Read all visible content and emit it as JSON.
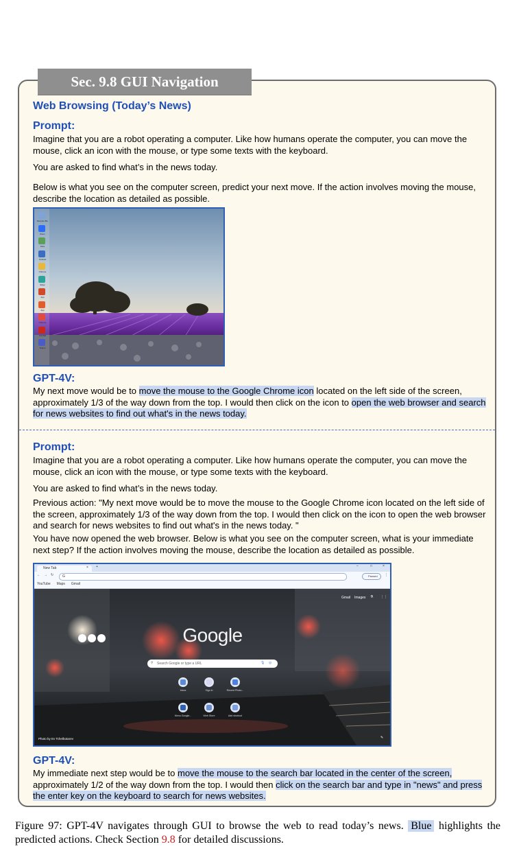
{
  "section": {
    "title": "Sec. 9.8 GUI Navigation"
  },
  "heading": "Web Browsing (Today’s News)",
  "prompt1": {
    "label": "Prompt:",
    "p1": "Imagine that you are a robot operating a computer. Like how humans operate the computer, you can move the mouse, click an icon with the mouse, or type some texts with the keyboard.",
    "p2": "You are asked to find what’s in the news today.",
    "p3": "Below is what you see on the computer screen, predict your next move. If the action involves moving the mouse, describe the location as detailed as possible."
  },
  "desktop": {
    "icons": [
      {
        "label": "Recycle Bin",
        "color": "#7fa3d6"
      },
      {
        "label": "Zoom",
        "color": "#2d6df6"
      },
      {
        "label": "Files",
        "color": "#5aa05a"
      },
      {
        "label": "Outlook",
        "color": "#3b6ec2"
      },
      {
        "label": "Chrome",
        "color": "#e9b73a"
      },
      {
        "label": "Edge",
        "color": "#2fa39a"
      },
      {
        "label": "App",
        "color": "#d04a2a"
      },
      {
        "label": "App",
        "color": "#e35d2b"
      },
      {
        "label": "Chrome",
        "color": "#e24b3b"
      },
      {
        "label": "Acrobat",
        "color": "#c9281e"
      },
      {
        "label": "Teams",
        "color": "#4a5cc5"
      }
    ]
  },
  "gpt1": {
    "label": "GPT-4V:",
    "t1": "My next move would be to ",
    "h1": "move the mouse to the Google Chrome icon",
    "t2": " located on the left side of the screen, approximately 1/3 of the way down from the top. I would then click on the icon to ",
    "h2": "open the web browser and search for news websites to find out what's in the news today."
  },
  "prompt2": {
    "label": "Prompt:",
    "p1": "Imagine that you are a robot operating a computer. Like how humans operate the computer, you can move the mouse, click an icon with the mouse, or type some texts with the keyboard.",
    "p2": "You are asked to find what’s in the news today.",
    "p3": "Previous action: \"My next move would be to move the mouse to the Google Chrome icon located on the left side of the screen, approximately 1/3 of the way down from the top. I would then click on the icon to open the web browser and search for news websites to find out what's in the news today. \"",
    "p4": "You have now opened the web browser. Below is what you see on the computer screen, what is your immediate next step? If the action involves moving the mouse, describe the location as detailed as possible."
  },
  "browser": {
    "tab_title": "New Tab",
    "address": "G",
    "bookmarks": [
      "YouTube",
      "Maps",
      "Gmail"
    ],
    "top_links": [
      "Gmail",
      "Images"
    ],
    "logo": "Google",
    "search_placeholder": "Search Google or type a URL",
    "shortcuts": [
      {
        "label": "Inbox",
        "color": "#5b8ad6"
      },
      {
        "label": "Sign in",
        "color": "#d6d6f0"
      },
      {
        "label": "Recent Photo...",
        "color": "#4f7fe0"
      },
      {
        "label": "Menu Google...",
        "color": "#2f5fb5"
      },
      {
        "label": "Web Store",
        "color": "#6b8fd0"
      },
      {
        "label": "Add shortcut",
        "color": "#7aa0e0"
      }
    ],
    "photo_credit": "Photo by Ev Tchelbotarev",
    "profile": "Paused"
  },
  "gpt2": {
    "label": "GPT-4V:",
    "t1": "My immediate next step would be to ",
    "h1": "move the mouse to the search bar located in the center of the screen,",
    "t2": " approximately 1/2 of the way down from the top. I would then ",
    "h2": "click on the search bar and type in \"news\" and press the enter key on the keyboard to search for news websites."
  },
  "caption": {
    "t1": "Figure 97: GPT-4V navigates through GUI to browse the web to read today’s news. ",
    "blue": "Blue",
    "t2": " highlights the predicted actions. Check Section ",
    "ref": "9.8",
    "t3": " for detailed discussions."
  }
}
